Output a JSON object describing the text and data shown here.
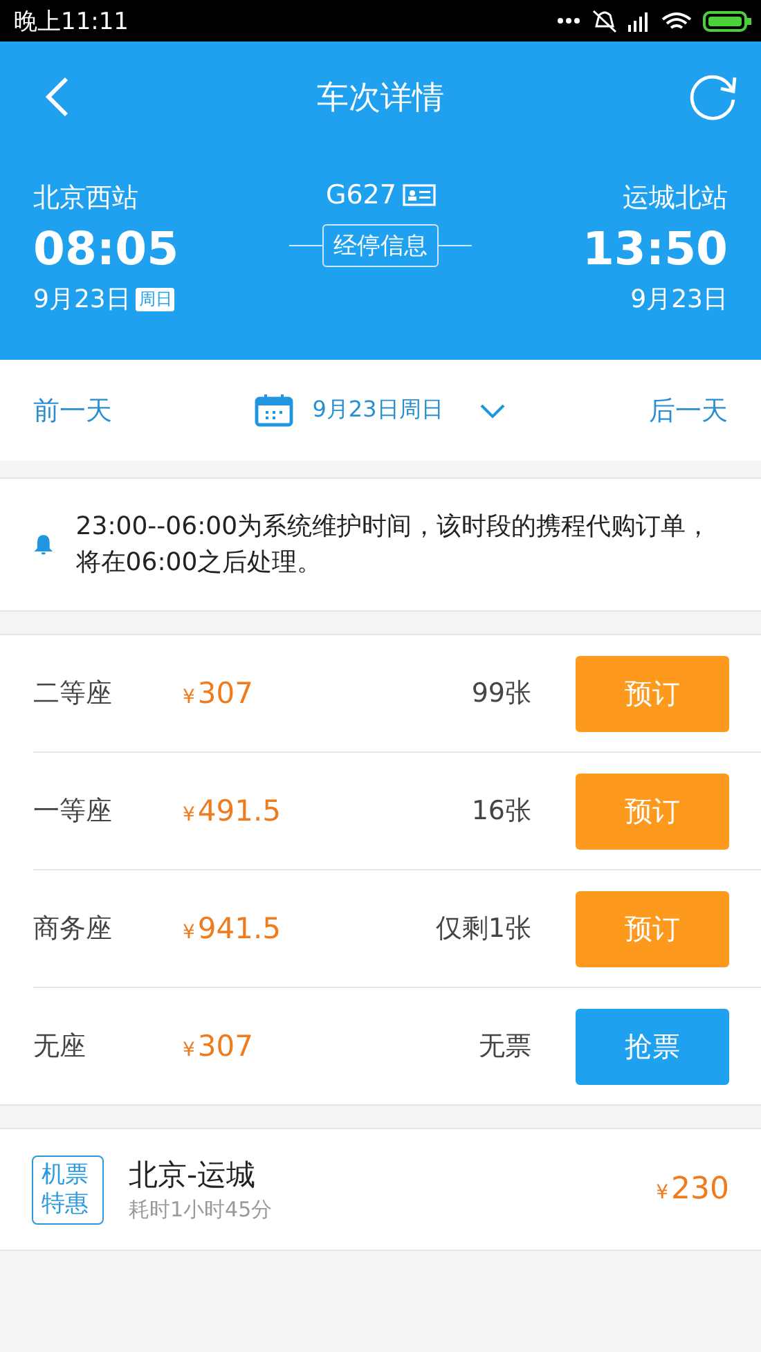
{
  "status_bar": {
    "time": "晚上11:11"
  },
  "header": {
    "title": "车次详情"
  },
  "trip": {
    "from_station": "北京西站",
    "depart_time": "08:05",
    "depart_date": "9月23日",
    "depart_weekday": "周日",
    "train_no": "G627",
    "stops_button": "经停信息",
    "to_station": "运城北站",
    "arrive_time": "13:50",
    "arrive_date": "9月23日"
  },
  "date_bar": {
    "prev": "前一天",
    "date": "9月23日周日",
    "next": "后一天"
  },
  "notice": "23:00--06:00为系统维护时间，该时段的携程代购订单，将在06:00之后处理。",
  "seats": [
    {
      "name": "二等座",
      "currency": "¥",
      "price": "307",
      "count": "99张",
      "button": "预订",
      "kind": "book"
    },
    {
      "name": "一等座",
      "currency": "¥",
      "price": "491.5",
      "count": "16张",
      "button": "预订",
      "kind": "book"
    },
    {
      "name": "商务座",
      "currency": "¥",
      "price": "941.5",
      "count": "仅剩1张",
      "button": "预订",
      "kind": "book"
    },
    {
      "name": "无座",
      "currency": "¥",
      "price": "307",
      "count": "无票",
      "button": "抢票",
      "kind": "grab"
    }
  ],
  "flight": {
    "badge": "机票特惠",
    "route": "北京-运城",
    "duration": "耗时1小时45分",
    "currency": "¥",
    "price": "230"
  }
}
